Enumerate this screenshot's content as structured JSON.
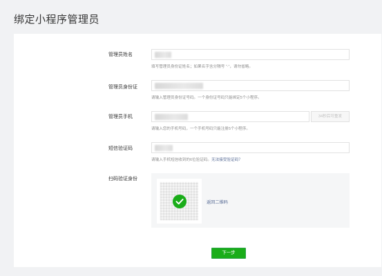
{
  "page": {
    "title": "绑定小程序管理员"
  },
  "form": {
    "name": {
      "label": "管理员姓名",
      "hint": "填写管理员身份证姓名；如果名字含分隔号 “·”，请勿省略。"
    },
    "id_card": {
      "label": "管理员身份证",
      "hint": "请输入管理员身份证号码。一个身份证号码只能绑定5个小程序。"
    },
    "phone": {
      "label": "管理员手机",
      "hint": "请输入您的手机号码，一个手机号码只能注册5个小程序。",
      "send_button": "34秒后可重发"
    },
    "sms": {
      "label": "短信验证码",
      "hint_prefix": "请输入手机短信收到的6位验证码。",
      "hint_link": "无法接受验证码？"
    },
    "scan": {
      "label": "扫码验证身份",
      "qr_link": "返回二维码"
    }
  },
  "actions": {
    "next": "下一步"
  },
  "colors": {
    "primary": "#1aad19",
    "link": "#576b95"
  }
}
